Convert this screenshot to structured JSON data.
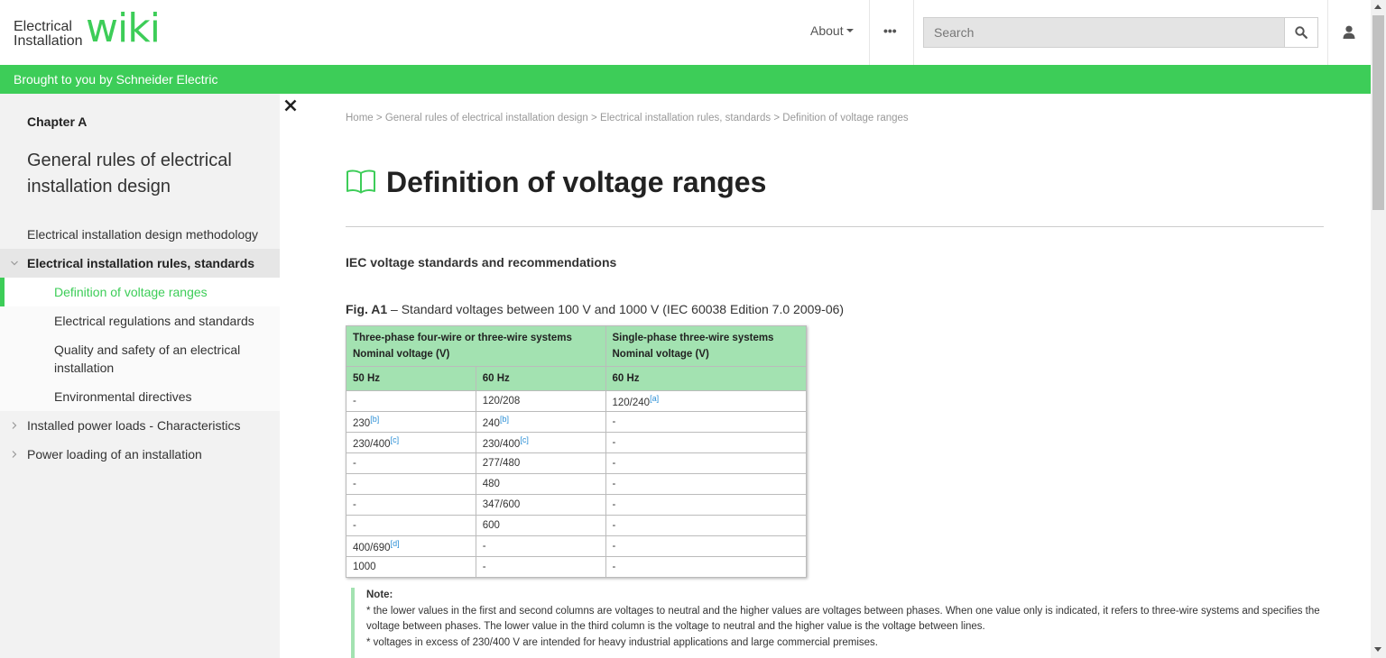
{
  "header": {
    "logo_line1": "Electrical",
    "logo_line2": "Installation",
    "logo_wiki": "wiki",
    "about_label": "About",
    "more_label": "•••",
    "search_placeholder": "Search",
    "icons": {
      "search": "search-icon",
      "user": "user-icon",
      "more": "more-icon"
    }
  },
  "banner": {
    "text": "Brought to you by Schneider Electric"
  },
  "sidebar": {
    "chapter": "Chapter A",
    "chapter_title": "General rules of electrical installation design",
    "items": [
      {
        "label": "Electrical installation design methodology"
      },
      {
        "label": "Electrical installation rules, standards"
      },
      {
        "label": "Definition of voltage ranges"
      },
      {
        "label": "Electrical regulations and standards"
      },
      {
        "label": "Quality and safety of an electrical installation"
      },
      {
        "label": "Environmental directives"
      },
      {
        "label": "Installed power loads - Characteristics"
      },
      {
        "label": "Power loading of an installation"
      }
    ]
  },
  "breadcrumb": {
    "items": [
      "Home",
      "General rules of electrical installation design",
      "Electrical installation rules, standards",
      "Definition of voltage ranges"
    ],
    "separator": ">"
  },
  "main": {
    "title": "Definition of voltage ranges",
    "section_heading": "IEC voltage standards and recommendations",
    "fig_label": "Fig. A1",
    "fig_caption": "– Standard voltages between 100 V and 1000 V (IEC 60038 Edition 7.0 2009-06)",
    "table": {
      "header_three_phase": "Three-phase four-wire or three-wire systems Nominal voltage (V)",
      "header_single_phase": "Single-phase three-wire systems Nominal voltage (V)",
      "sub_headers": [
        "50 Hz",
        "60 Hz",
        "60 Hz"
      ],
      "rows": [
        {
          "c1": "-",
          "c1s": "",
          "c2": "120/208",
          "c2s": "",
          "c3": "120/240",
          "c3s": "[a]"
        },
        {
          "c1": "230",
          "c1s": "[b]",
          "c2": "240",
          "c2s": "[b]",
          "c3": "-",
          "c3s": ""
        },
        {
          "c1": "230/400",
          "c1s": "[c]",
          "c2": "230/400",
          "c2s": "[c]",
          "c3": "-",
          "c3s": ""
        },
        {
          "c1": "-",
          "c1s": "",
          "c2": "277/480",
          "c2s": "",
          "c3": "-",
          "c3s": ""
        },
        {
          "c1": "-",
          "c1s": "",
          "c2": "480",
          "c2s": "",
          "c3": "-",
          "c3s": ""
        },
        {
          "c1": "-",
          "c1s": "",
          "c2": "347/600",
          "c2s": "",
          "c3": "-",
          "c3s": ""
        },
        {
          "c1": "-",
          "c1s": "",
          "c2": "600",
          "c2s": "",
          "c3": "-",
          "c3s": ""
        },
        {
          "c1": "400/690",
          "c1s": "[d]",
          "c2": "-",
          "c2s": "",
          "c3": "-",
          "c3s": ""
        },
        {
          "c1": "1000",
          "c1s": "",
          "c2": "-",
          "c2s": "",
          "c3": "-",
          "c3s": ""
        }
      ]
    },
    "note": {
      "title": "Note:",
      "lines": [
        "* the lower values in the first and second columns are voltages to neutral and the higher values are voltages between phases. When one value only is indicated, it refers to three-wire systems and specifies the voltage between phases. The lower value in the third column is the voltage to neutral and the higher value is the voltage between lines.",
        "* voltages in excess of 230/400 V are intended for heavy industrial applications and large commercial premises."
      ]
    }
  },
  "colors": {
    "brand_green": "#3dcd58",
    "table_header": "#a3e2b1",
    "link_blue": "#2b8fd6"
  }
}
